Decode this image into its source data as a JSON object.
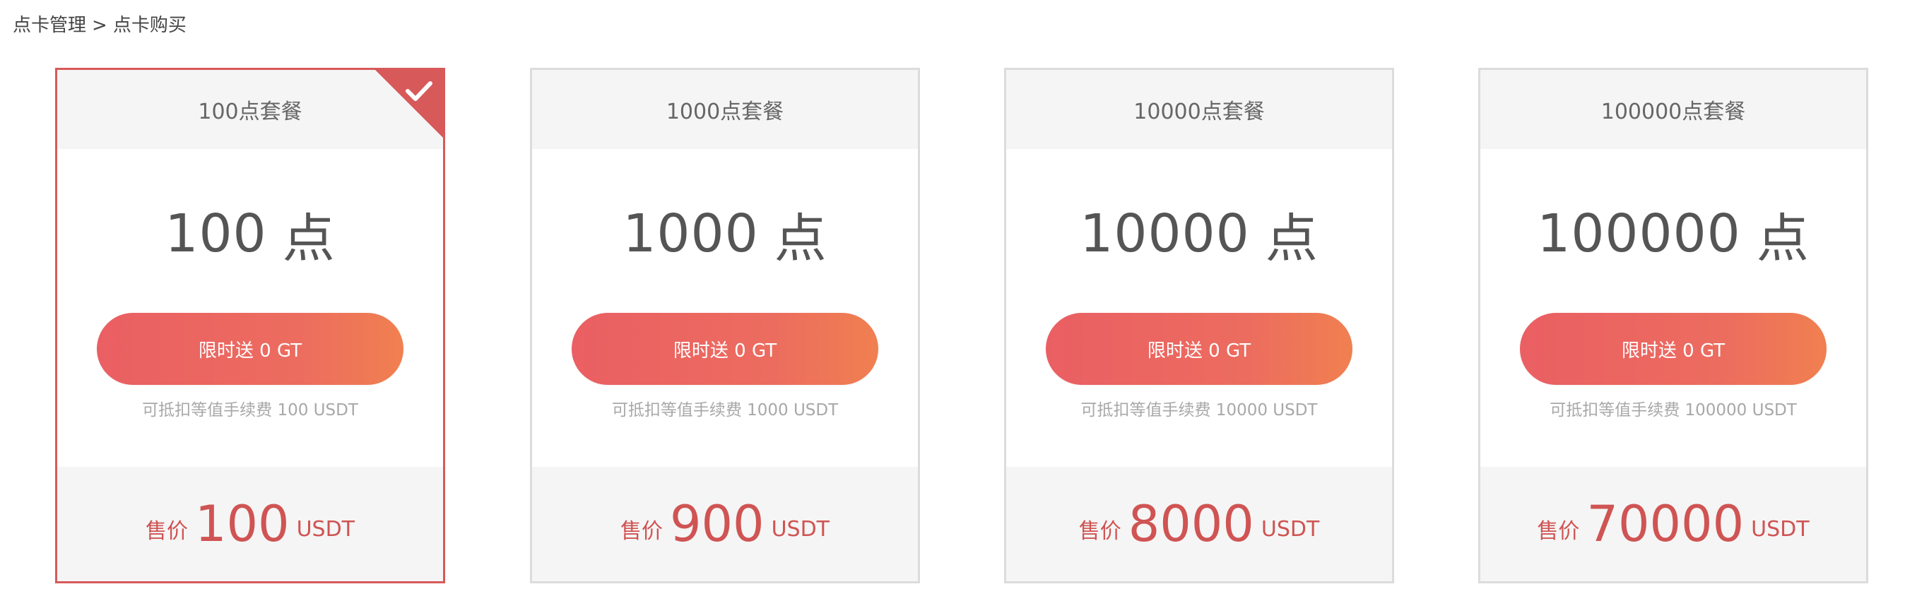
{
  "breadcrumb": {
    "parent": "点卡管理",
    "separator": ">",
    "current": "点卡购买"
  },
  "colors": {
    "accent": "#d7595a",
    "button_gradient_start": "#ea5f63",
    "button_gradient_end": "#f08050",
    "card_border": "#dcdcdc",
    "header_bg": "#f5f5f5"
  },
  "packages": [
    {
      "title": "100点套餐",
      "points": "100",
      "points_unit": "点",
      "promo": "限时送 0 GT",
      "note": "可抵扣等值手续费 100 USDT",
      "price_label": "售价",
      "price": "100",
      "currency": "USDT",
      "selected": true
    },
    {
      "title": "1000点套餐",
      "points": "1000",
      "points_unit": "点",
      "promo": "限时送 0 GT",
      "note": "可抵扣等值手续费 1000 USDT",
      "price_label": "售价",
      "price": "900",
      "currency": "USDT",
      "selected": false
    },
    {
      "title": "10000点套餐",
      "points": "10000",
      "points_unit": "点",
      "promo": "限时送 0 GT",
      "note": "可抵扣等值手续费 10000 USDT",
      "price_label": "售价",
      "price": "8000",
      "currency": "USDT",
      "selected": false
    },
    {
      "title": "100000点套餐",
      "points": "100000",
      "points_unit": "点",
      "promo": "限时送 0 GT",
      "note": "可抵扣等值手续费 100000 USDT",
      "price_label": "售价",
      "price": "70000",
      "currency": "USDT",
      "selected": false
    }
  ],
  "icons": {
    "selected_marker": "check-icon"
  }
}
